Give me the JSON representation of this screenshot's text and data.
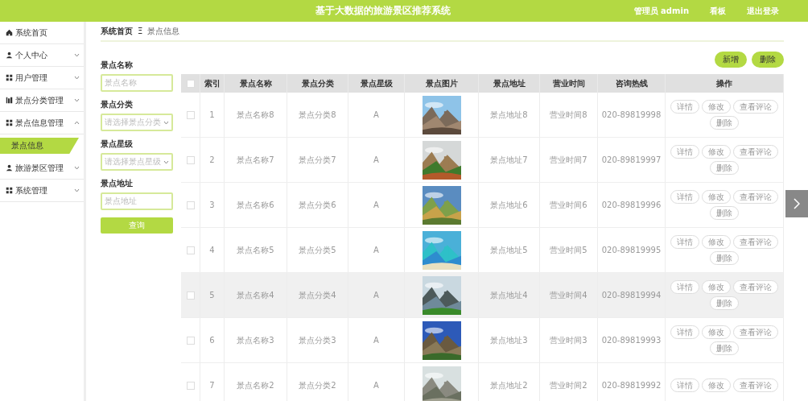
{
  "header": {
    "title": "基于大数据的旅游景区推荐系统",
    "links": [
      "管理员 admin",
      "看板",
      "退出登录"
    ]
  },
  "sidebar": {
    "items": [
      {
        "label": "系统首页"
      },
      {
        "label": "个人中心",
        "expanded": false
      },
      {
        "label": "用户管理",
        "expanded": false
      },
      {
        "label": "景点分类管理",
        "expanded": false
      },
      {
        "label": "景点信息管理",
        "expanded": true,
        "children": [
          {
            "label": "景点信息",
            "selected": true
          }
        ]
      },
      {
        "label": "旅游景区管理",
        "expanded": false
      },
      {
        "label": "系统管理",
        "expanded": false
      }
    ]
  },
  "breadcrumb": {
    "home": "系统首页",
    "separator": "Ξ",
    "current": "景点信息"
  },
  "filters": [
    {
      "kind": "input",
      "label": "景点名称",
      "placeholder": "景点名称"
    },
    {
      "kind": "select",
      "label": "景点分类",
      "placeholder": "请选择景点分类"
    },
    {
      "kind": "select",
      "label": "景点星级",
      "placeholder": "请选择景点星级"
    },
    {
      "kind": "input",
      "label": "景点地址",
      "placeholder": "景点地址"
    }
  ],
  "search_button": "查询",
  "actions": [
    "新增",
    "删除"
  ],
  "table": {
    "select_all_checked": false,
    "columns": [
      "索引",
      "景点名称",
      "景点分类",
      "景点星级",
      "景点图片",
      "景点地址",
      "营业时间",
      "咨询热线",
      "操作"
    ],
    "rows": [
      {
        "index": "1",
        "name": "景点名称8",
        "category": "景点分类8",
        "level": "A",
        "address": "景点地址8",
        "hours": "营业时间8",
        "phone": "020-89819998",
        "highlighted": false,
        "checked": false,
        "buttons": [
          "详情",
          "修改",
          "查看评论",
          "删除"
        ]
      },
      {
        "index": "2",
        "name": "景点名称7",
        "category": "景点分类7",
        "level": "A",
        "address": "景点地址7",
        "hours": "营业时间7",
        "phone": "020-89819997",
        "highlighted": false,
        "checked": false,
        "buttons": [
          "详情",
          "修改",
          "查看评论",
          "删除"
        ]
      },
      {
        "index": "3",
        "name": "景点名称6",
        "category": "景点分类6",
        "level": "A",
        "address": "景点地址6",
        "hours": "营业时间6",
        "phone": "020-89819996",
        "highlighted": false,
        "checked": false,
        "buttons": [
          "详情",
          "修改",
          "查看评论",
          "删除"
        ]
      },
      {
        "index": "4",
        "name": "景点名称5",
        "category": "景点分类5",
        "level": "A",
        "address": "景点地址5",
        "hours": "营业时间5",
        "phone": "020-89819995",
        "highlighted": false,
        "checked": false,
        "buttons": [
          "详情",
          "修改",
          "查看评论",
          "删除"
        ]
      },
      {
        "index": "5",
        "name": "景点名称4",
        "category": "景点分类4",
        "level": "A",
        "address": "景点地址4",
        "hours": "营业时间4",
        "phone": "020-89819994",
        "highlighted": true,
        "checked": false,
        "buttons": [
          "详情",
          "修改",
          "查看评论",
          "删除"
        ]
      },
      {
        "index": "6",
        "name": "景点名称3",
        "category": "景点分类3",
        "level": "A",
        "address": "景点地址3",
        "hours": "营业时间3",
        "phone": "020-89819993",
        "highlighted": false,
        "checked": false,
        "buttons": [
          "详情",
          "修改",
          "查看评论",
          "删除"
        ]
      },
      {
        "index": "7",
        "name": "景点名称2",
        "category": "景点分类2",
        "level": "A",
        "address": "景点地址2",
        "hours": "营业时间2",
        "phone": "020-89819992",
        "highlighted": false,
        "checked": false,
        "buttons": [
          "详情",
          "修改",
          "查看评论"
        ]
      }
    ]
  }
}
